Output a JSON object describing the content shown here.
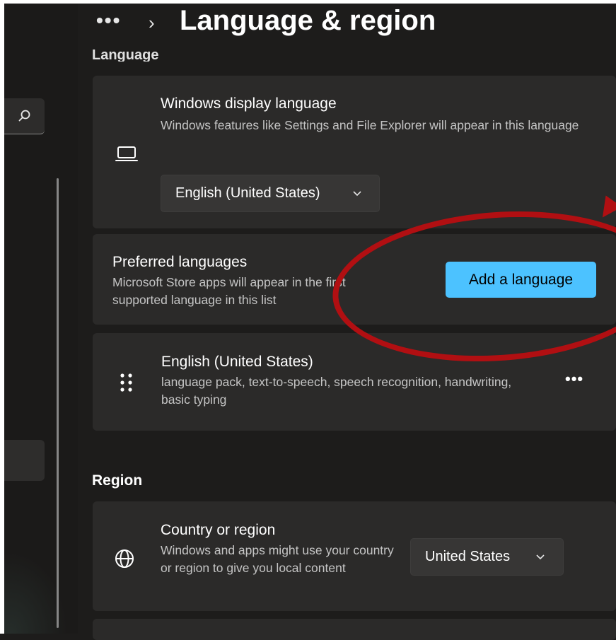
{
  "header": {
    "overflow_label": "•••",
    "chevron": "›",
    "title": "Language & region"
  },
  "sections": {
    "language_heading": "Language",
    "region_heading": "Region"
  },
  "display_language": {
    "title": "Windows display language",
    "description": "Windows features like Settings and File Explorer will appear in this language",
    "icon": "laptop-icon",
    "selected": "English (United States)"
  },
  "preferred_languages": {
    "title": "Preferred languages",
    "description": "Microsoft Store apps will appear in the first supported language in this list",
    "add_button_label": "Add a language"
  },
  "installed_languages": [
    {
      "name": "English (United States)",
      "features": "language pack, text-to-speech, speech recognition, handwriting, basic typing",
      "icon": "drag-handle-icon",
      "more_label": "•••"
    }
  ],
  "country_region": {
    "title": "Country or region",
    "description": "Windows and apps might use your country or region to give you local content",
    "icon": "globe-icon",
    "selected": "United States"
  },
  "colors": {
    "accent": "#4cc2ff",
    "annotation": "#b10f12",
    "card": "#2b2a29",
    "background": "#1d1c1b"
  }
}
